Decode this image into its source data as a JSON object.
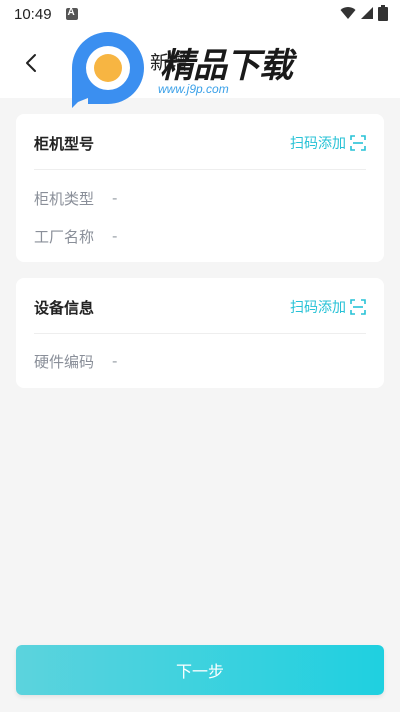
{
  "status_bar": {
    "time": "10:49"
  },
  "header": {
    "title": "新增",
    "back_icon": "chevron-left-icon"
  },
  "watermark": {
    "text": "精品下载",
    "url": "www.j9p.com"
  },
  "cabinet_model_card": {
    "title": "柜机型号",
    "scan_label": "扫码添加",
    "fields": [
      {
        "label": "柜机类型",
        "value": "-"
      },
      {
        "label": "工厂名称",
        "value": "-"
      }
    ]
  },
  "device_info_card": {
    "title": "设备信息",
    "scan_label": "扫码添加",
    "fields": [
      {
        "label": "硬件编码",
        "value": "-"
      }
    ]
  },
  "footer": {
    "next_label": "下一步"
  },
  "colors": {
    "accent": "#27c2d6",
    "button_start": "#5cd3dd",
    "button_end": "#1fd0e0",
    "background": "#f5f5f5"
  }
}
